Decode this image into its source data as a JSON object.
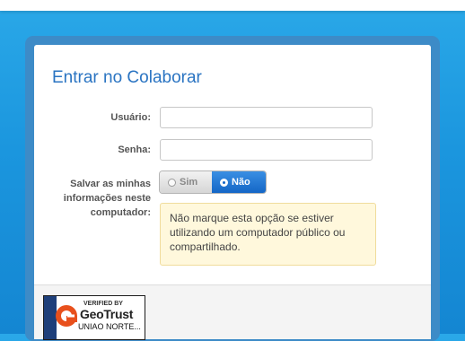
{
  "login": {
    "title": "Entrar no Colaborar",
    "username_label": "Usuário:",
    "password_label": "Senha:",
    "remember_label": "Salvar as minhas informações neste computador:",
    "remember_yes": "Sim",
    "remember_no": "Não",
    "remember_selected": "Não",
    "note": "Não marque esta opção se estiver utilizando um computador público ou compartilhado."
  },
  "badge": {
    "verified_text": "VERIFIED BY",
    "brand": "GeoTrust",
    "owner": "UNIAO NORTE..."
  },
  "colors": {
    "accent": "#2a74c2",
    "selected_toggle": "#1466c6",
    "note_background": "#fff8dc"
  }
}
